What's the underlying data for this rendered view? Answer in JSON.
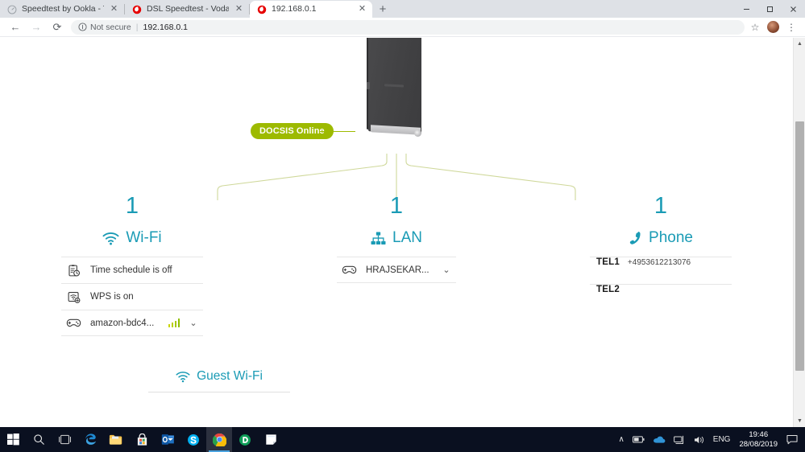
{
  "browser": {
    "tabs": [
      {
        "title": "Speedtest by Ookla - The Global",
        "favicon": "speedtest-gauge-icon",
        "active": false
      },
      {
        "title": "DSL Speedtest - Vodafone",
        "favicon": "vodafone-logo-icon",
        "active": false
      },
      {
        "title": "192.168.0.1",
        "favicon": "vodafone-logo-icon",
        "active": true
      }
    ],
    "new_tab_label": "+",
    "close_label": "✕",
    "window_controls": {
      "minimize": "─",
      "maximize": "☐",
      "close": "✕"
    },
    "toolbar": {
      "back": "←",
      "forward": "→",
      "reload": "⟳",
      "security_label": "Not secure",
      "security_divider": "|",
      "url": "192.168.0.1",
      "bookmark": "☆",
      "menu": "⋮"
    }
  },
  "page": {
    "status_badge": "DOCSIS Online",
    "columns": [
      {
        "count": "1",
        "label": "Wi-Fi",
        "icon": "wifi-icon",
        "rows": [
          {
            "icon": "schedule-clock-icon",
            "label": "Time schedule is off",
            "type": "plain"
          },
          {
            "icon": "wps-icon",
            "label": "WPS is on",
            "type": "plain"
          },
          {
            "icon": "gamepad-icon",
            "label": "amazon-bdc4...",
            "type": "device",
            "signal": 4,
            "chevron": "⌄"
          }
        ]
      },
      {
        "count": "1",
        "label": "LAN",
        "icon": "lan-tree-icon",
        "rows": [
          {
            "icon": "gamepad-icon",
            "label": "HRAJSEKAR...",
            "type": "device",
            "chevron": "⌄"
          }
        ]
      },
      {
        "count": "1",
        "label": "Phone",
        "icon": "phone-handset-icon",
        "rows": [
          {
            "key": "TEL1",
            "value": "+4953612213076"
          },
          {
            "key": "TEL2",
            "value": ""
          }
        ]
      }
    ],
    "guest_wifi": {
      "label": "Guest Wi-Fi",
      "icon": "wifi-icon"
    }
  },
  "colors": {
    "badge_green": "#9dba00",
    "accent_teal": "#1a9bb5",
    "connector_line": "#cfd89a"
  },
  "taskbar": {
    "icons": [
      "windows-start-icon",
      "search-icon",
      "task-view-icon",
      "edge-icon",
      "file-explorer-icon",
      "microsoft-store-icon",
      "outlook-icon",
      "skype-icon",
      "chrome-icon",
      "dashlane-icon",
      "sticky-notes-icon"
    ],
    "tray": {
      "show_hidden": "∧",
      "battery": "battery-icon",
      "onedrive": "onedrive-cloud-icon",
      "network": "network-icon",
      "volume": "volume-icon",
      "language": "ENG",
      "time": "19:46",
      "date": "28/08/2019",
      "action_center": "action-center-icon"
    }
  }
}
